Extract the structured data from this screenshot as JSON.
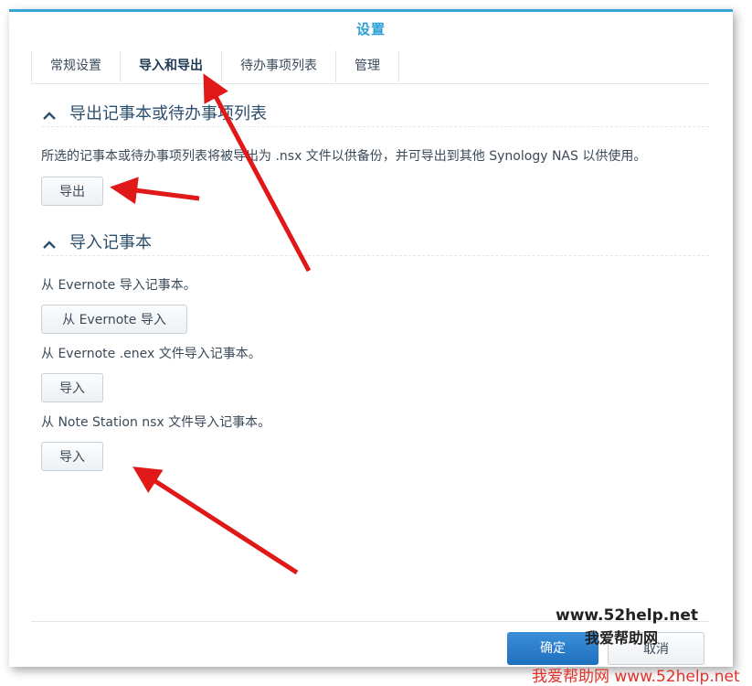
{
  "window": {
    "title": "设置"
  },
  "tabs": [
    {
      "label": "常规设置"
    },
    {
      "label": "导入和导出",
      "active": true
    },
    {
      "label": "待办事项列表"
    },
    {
      "label": "管理"
    }
  ],
  "export_section": {
    "heading": "导出记事本或待办事项列表",
    "description": "所选的记事本或待办事项列表将被导出为 .nsx 文件以供备份，并可导出到其他 Synology NAS 以供使用。",
    "button_label": "导出"
  },
  "import_section": {
    "heading": "导入记事本",
    "evernote_desc": "从 Evernote 导入记事本。",
    "evernote_button": "从 Evernote 导入",
    "enex_desc": "从 Evernote .enex 文件导入记事本。",
    "enex_button": "导入",
    "nsx_desc": "从 Note Station nsx 文件导入记事本。",
    "nsx_button": "导入"
  },
  "footer": {
    "ok_label": "确定",
    "cancel_label": "取消"
  },
  "watermark": {
    "line1": "www.52help.net",
    "line2": "我爱帮助网",
    "line3": "我爱帮助网 www.52help.net"
  },
  "colors": {
    "title": "#2a9fd6",
    "ok_button": "#2a7fcf",
    "arrow": "#e01818",
    "watermark_red": "#e0322b"
  }
}
